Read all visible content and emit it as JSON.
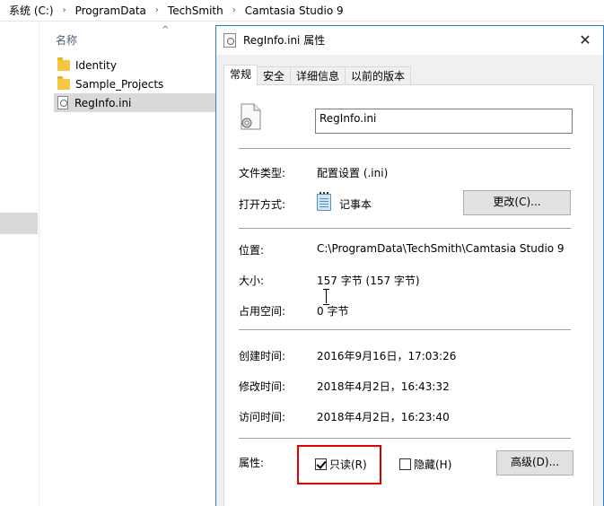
{
  "explorer": {
    "breadcrumb": [
      "系统 (C:)",
      "ProgramData",
      "TechSmith",
      "Camtasia Studio 9"
    ],
    "column_header": "名称",
    "files": [
      {
        "name": "Identity",
        "type": "folder"
      },
      {
        "name": "Sample_Projects",
        "type": "folder"
      },
      {
        "name": "RegInfo.ini",
        "type": "ini-file",
        "selected": true
      }
    ]
  },
  "dialog": {
    "title": "RegInfo.ini 属性",
    "close_glyph": "✕",
    "tabs": [
      "常规",
      "安全",
      "详细信息",
      "以前的版本"
    ],
    "active_tab": "常规",
    "file_name": "RegInfo.ini",
    "file_type_label": "文件类型:",
    "file_type_value": "配置设置 (.ini)",
    "open_with_label": "打开方式:",
    "open_with_value": "记事本",
    "change_button": "更改(C)...",
    "location_label": "位置:",
    "location_value": "C:\\ProgramData\\TechSmith\\Camtasia Studio 9",
    "size_label": "大小:",
    "size_value": "157 字节 (157 字节)",
    "size_on_disk_label": "占用空间:",
    "size_on_disk_value": "0 字节",
    "created_label": "创建时间:",
    "created_value": "2016年9月16日，17:03:26",
    "modified_label": "修改时间:",
    "modified_value": "2018年4月2日，16:43:32",
    "accessed_label": "访问时间:",
    "accessed_value": "2018年4月2日，16:23:40",
    "attributes_label": "属性:",
    "readonly_label": "只读(R)",
    "readonly_checked": true,
    "hidden_label": "隐藏(H)",
    "hidden_checked": false,
    "advanced_button": "高级(D)..."
  },
  "colors": {
    "dialog_border": "#2a80d2",
    "highlight": "#e00000"
  }
}
